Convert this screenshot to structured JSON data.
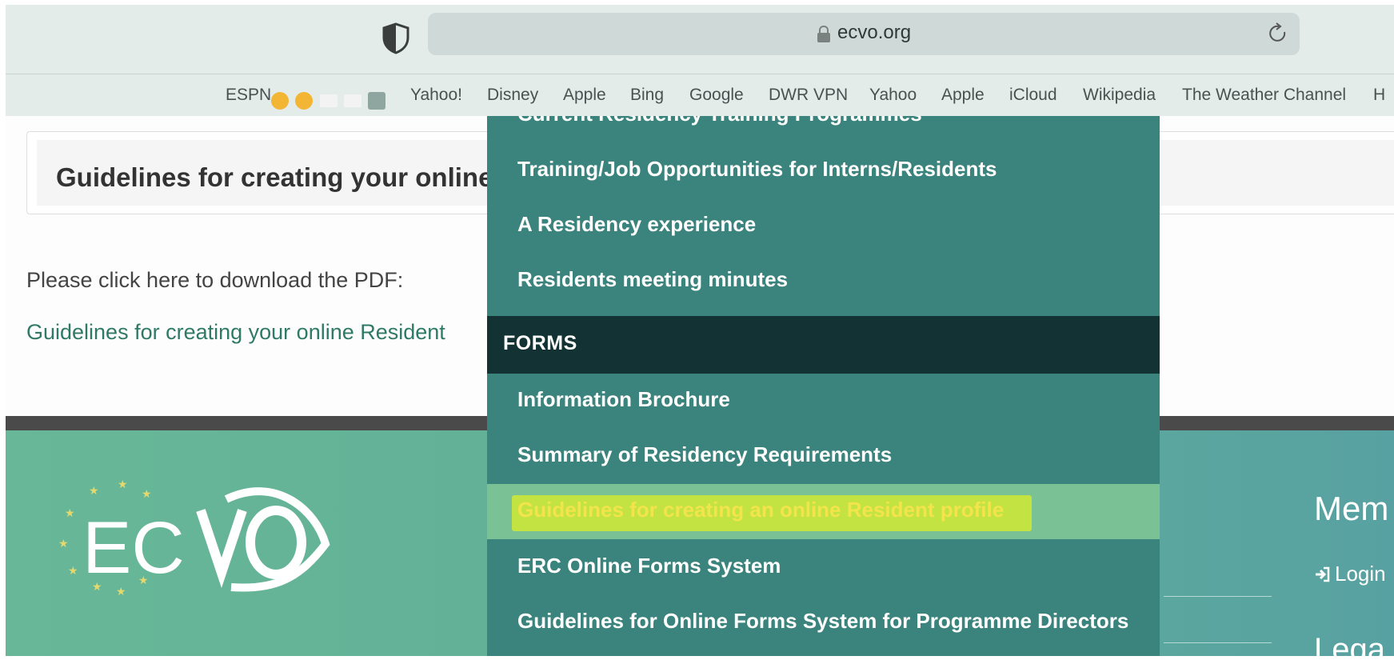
{
  "browser": {
    "url": "ecvo.org",
    "bookmarks": [
      "ESPN",
      "Yahoo!",
      "Disney",
      "Apple",
      "Bing",
      "Google",
      "DWR VPN",
      "Yahoo",
      "Apple",
      "iCloud",
      "Wikipedia",
      "The Weather Channel",
      "H"
    ]
  },
  "page": {
    "title": "Guidelines for creating your online",
    "pdf_prompt": "Please click here to download the PDF:",
    "pdf_link": "Guidelines for creating your online Resident"
  },
  "menu": {
    "partial_item": "Current Residency Training Programmes",
    "items_top": [
      "Training/Job Opportunities for Interns/Residents",
      "A Residency experience",
      "Residents meeting minutes"
    ],
    "section_header": "FORMS",
    "items_forms": [
      "Information Brochure",
      "Summary of Residency Requirements",
      "Guidelines for creating an online Resident profile",
      "ERC Online Forms System",
      "Guidelines for Online Forms System for Programme Directors"
    ],
    "active_index": 2
  },
  "footer": {
    "logo_text": "ECVO",
    "members_heading": "Mem",
    "login_label": "Login",
    "legal_heading": "Lega"
  },
  "colors": {
    "menu_bg": "#3b837d",
    "menu_header_bg": "#123234",
    "active_item_bg": "#7ac195",
    "highlight": "#c3e343",
    "link": "#2f7a66"
  }
}
